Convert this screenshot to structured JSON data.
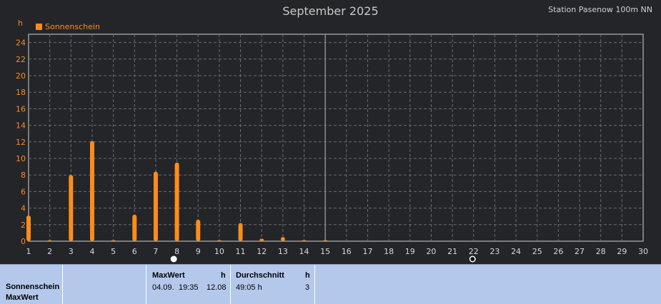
{
  "title": "September 2025",
  "station": "Station Pasenow 100m NN",
  "y_unit": "h",
  "legend_label": "Sonnenschein",
  "colors": {
    "background": "#232529",
    "series": "#ff8c1a",
    "grid": "#6a6c70",
    "axis": "#9a9a9a",
    "table": "#b4c8ec"
  },
  "moon_icons": [
    {
      "name": "full-moon-icon",
      "day": 7.85
    },
    {
      "name": "new-moon-icon",
      "day": 21.95
    }
  ],
  "chart_data": {
    "type": "bar",
    "title": "September 2025",
    "ylabel": "h",
    "ylim": [
      0,
      25
    ],
    "xlim": [
      1,
      30
    ],
    "yticks": [
      0,
      2,
      4,
      6,
      8,
      10,
      12,
      14,
      16,
      18,
      20,
      22,
      24
    ],
    "xticks": [
      1,
      2,
      3,
      4,
      5,
      6,
      7,
      8,
      9,
      10,
      11,
      12,
      13,
      14,
      15,
      16,
      17,
      18,
      19,
      20,
      21,
      22,
      23,
      24,
      25,
      26,
      27,
      28,
      29,
      30
    ],
    "current_day_marker": 15,
    "grid": true,
    "legend": "top-left",
    "series": [
      {
        "name": "Sonnenschein",
        "color": "#ff8c1a",
        "x": [
          1,
          2,
          3,
          4,
          5,
          6,
          7,
          8,
          9,
          10,
          11,
          12,
          13,
          14,
          15
        ],
        "values": [
          3.1,
          0.0,
          8.0,
          12.1,
          0.1,
          3.2,
          8.4,
          9.5,
          2.6,
          0.1,
          2.2,
          0.3,
          0.5,
          0.1,
          0.1
        ]
      }
    ]
  },
  "table": {
    "row_labels": [
      "Sonnenschein",
      "MaxWert"
    ],
    "maxwert": {
      "header": "MaxWert",
      "unit": "h",
      "date": "04.09.",
      "time": "19:35",
      "value": "12.08"
    },
    "durchschnitt": {
      "header": "Durchschnitt",
      "unit": "h",
      "value": "49:05 h",
      "count": "3"
    }
  }
}
